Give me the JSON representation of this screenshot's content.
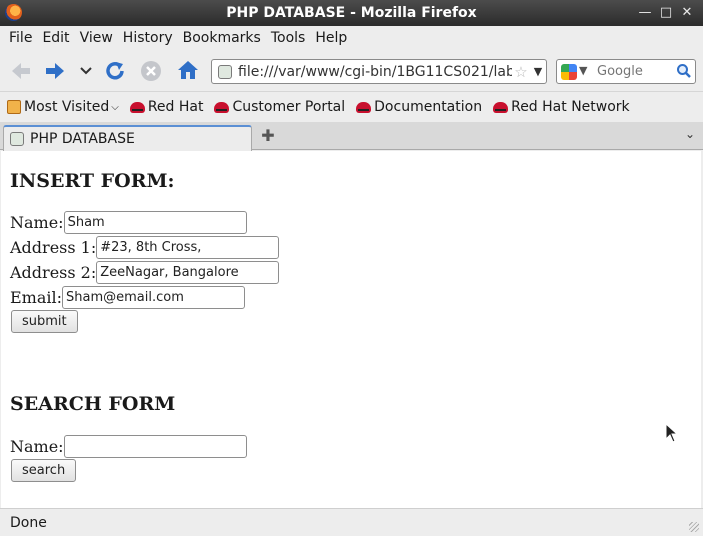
{
  "window": {
    "title": "PHP DATABASE - Mozilla Firefox",
    "controls": {
      "minimize": "✕"
    }
  },
  "menubar": [
    "File",
    "Edit",
    "View",
    "History",
    "Bookmarks",
    "Tools",
    "Help"
  ],
  "toolbar": {
    "url": "file:///var/www/cgi-bin/1BG11CS021/lab11",
    "search_placeholder": "Google"
  },
  "bookmarks": [
    "Most Visited",
    "Red Hat",
    "Customer Portal",
    "Documentation",
    "Red Hat Network"
  ],
  "tabs": [
    {
      "label": "PHP DATABASE"
    }
  ],
  "insert_form": {
    "heading": "INSERT FORM:",
    "fields": [
      {
        "label": "Name:",
        "value": "Sham"
      },
      {
        "label": "Address 1:",
        "value": "#23, 8th Cross,"
      },
      {
        "label": "Address 2:",
        "value": "ZeeNagar, Bangalore"
      },
      {
        "label": "Email:",
        "value": "Sham@email.com"
      }
    ],
    "submit_label": "submit"
  },
  "search_form": {
    "heading": "SEARCH FORM",
    "field_label": "Name:",
    "field_value": "",
    "search_label": "search"
  },
  "status": "Done",
  "colors": {
    "titlebar": "#3a3a3a",
    "tab_accent": "#5b8fd4",
    "redhat": "#c8102e"
  }
}
